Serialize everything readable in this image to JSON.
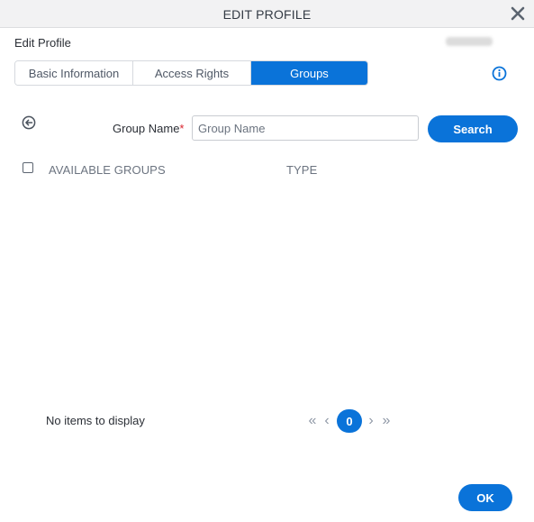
{
  "dialog": {
    "title": "EDIT PROFILE",
    "close_icon": "close-icon"
  },
  "section": {
    "title": "Edit Profile",
    "redacted_value": ""
  },
  "tabs": [
    {
      "label": "Basic Information",
      "active": false
    },
    {
      "label": "Access Rights",
      "active": false
    },
    {
      "label": "Groups",
      "active": true
    }
  ],
  "search": {
    "label": "Group Name",
    "required_marker": "*",
    "value": "",
    "placeholder": "Group Name",
    "button_label": "Search"
  },
  "table": {
    "columns": [
      "AVAILABLE GROUPS",
      "TYPE"
    ],
    "rows": [],
    "empty_message": "No items to display"
  },
  "pagination": {
    "current_page": "0",
    "first_glyph": "«",
    "prev_glyph": "‹",
    "next_glyph": "›",
    "last_glyph": "»"
  },
  "footer": {
    "ok_label": "OK"
  },
  "colors": {
    "accent": "#0a73d9",
    "required": "#d9232d"
  }
}
